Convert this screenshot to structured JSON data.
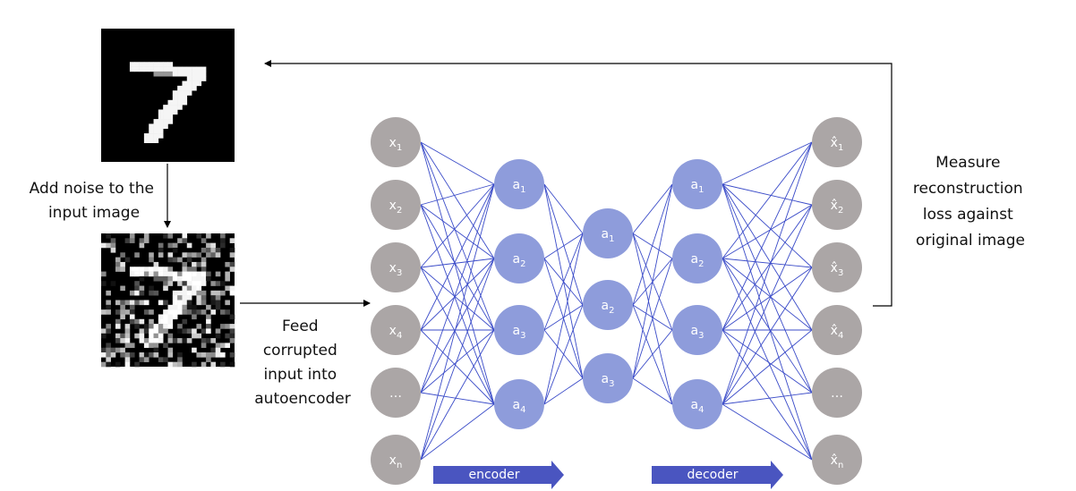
{
  "colors": {
    "input_node": "#aba6a6",
    "hidden_node": "#8e9cdb",
    "edge": "#3a4bc8",
    "arrow_fill": "#4a55c0",
    "flow_line": "#000000",
    "image_bg": "#000000"
  },
  "images": {
    "original": {
      "name": "original-digit-image",
      "digit": "7",
      "description": "MNIST digit 7"
    },
    "noisy": {
      "name": "noisy-digit-image",
      "digit": "7",
      "description": "MNIST digit 7 with random noise"
    }
  },
  "labels": {
    "add_noise": [
      "Add noise to the",
      "input image"
    ],
    "feed": [
      "Feed",
      "corrupted",
      "input into",
      "autoencoder"
    ],
    "measure": [
      "Measure",
      "reconstruction",
      "loss against",
      "original image"
    ]
  },
  "network": {
    "layers": [
      {
        "name": "input-layer",
        "type": "input",
        "nodes": [
          {
            "base": "x",
            "sub": "1"
          },
          {
            "base": "x",
            "sub": "2"
          },
          {
            "base": "x",
            "sub": "3"
          },
          {
            "base": "x",
            "sub": "4"
          },
          {
            "base": "…",
            "sub": ""
          },
          {
            "base": "x",
            "sub": "n"
          }
        ]
      },
      {
        "name": "encoder-hidden-layer",
        "type": "hidden",
        "nodes": [
          {
            "base": "a",
            "sub": "1"
          },
          {
            "base": "a",
            "sub": "2"
          },
          {
            "base": "a",
            "sub": "3"
          },
          {
            "base": "a",
            "sub": "4"
          }
        ]
      },
      {
        "name": "bottleneck-layer",
        "type": "hidden",
        "nodes": [
          {
            "base": "a",
            "sub": "1"
          },
          {
            "base": "a",
            "sub": "2"
          },
          {
            "base": "a",
            "sub": "3"
          }
        ]
      },
      {
        "name": "decoder-hidden-layer",
        "type": "hidden",
        "nodes": [
          {
            "base": "a",
            "sub": "1"
          },
          {
            "base": "a",
            "sub": "2"
          },
          {
            "base": "a",
            "sub": "3"
          },
          {
            "base": "a",
            "sub": "4"
          }
        ]
      },
      {
        "name": "output-layer",
        "type": "input",
        "nodes": [
          {
            "base": "x̂",
            "sub": "1"
          },
          {
            "base": "x̂",
            "sub": "2"
          },
          {
            "base": "x̂",
            "sub": "3"
          },
          {
            "base": "x̂",
            "sub": "4"
          },
          {
            "base": "…",
            "sub": ""
          },
          {
            "base": "x̂",
            "sub": "n"
          }
        ]
      }
    ],
    "encoder_label": "encoder",
    "decoder_label": "decoder"
  }
}
